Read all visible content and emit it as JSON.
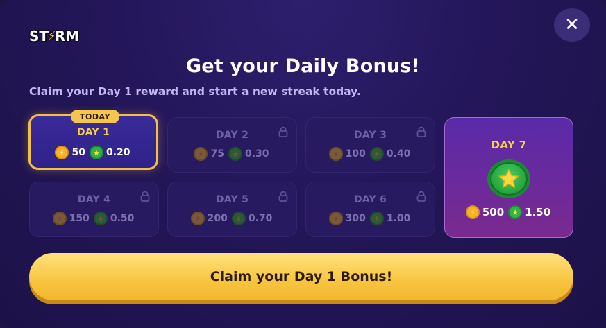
{
  "logo": {
    "text_before": "ST",
    "text_after": "RM"
  },
  "title": "Get your Daily Bonus!",
  "subtitle": "Claim your Day 1 reward and start a new streak today.",
  "days": [
    {
      "label": "DAY 1",
      "coins": "50",
      "stars": "0.20",
      "state": "today",
      "badge": "TODAY"
    },
    {
      "label": "DAY 2",
      "coins": "75",
      "stars": "0.30",
      "state": "locked"
    },
    {
      "label": "DAY 3",
      "coins": "100",
      "stars": "0.40",
      "state": "locked"
    },
    {
      "label": "DAY 4",
      "coins": "150",
      "stars": "0.50",
      "state": "locked"
    },
    {
      "label": "DAY 5",
      "coins": "200",
      "stars": "0.70",
      "state": "locked"
    },
    {
      "label": "DAY 6",
      "coins": "300",
      "stars": "1.00",
      "state": "locked"
    },
    {
      "label": "DAY 7",
      "coins": "500",
      "stars": "1.50",
      "state": "grand"
    }
  ],
  "claim_button": "Claim your Day 1 Bonus!",
  "colors": {
    "accent_gold": "#f7cf4e",
    "background": "#241659",
    "button": "#f8c440",
    "grand_card": "#6b2a9c"
  },
  "icons": {
    "coin": "lightning-coin-icon",
    "star": "star-token-icon",
    "lock": "lock-icon",
    "close": "close-icon"
  }
}
